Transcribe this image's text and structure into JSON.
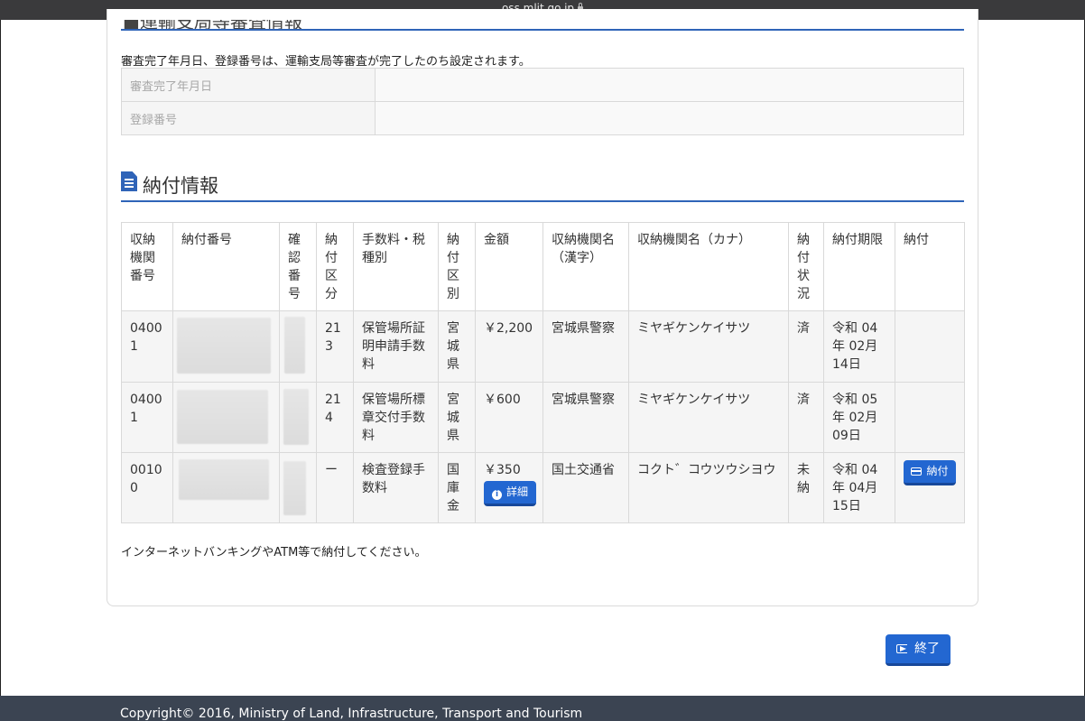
{
  "browser": {
    "url": "oss.mlit.go.jp"
  },
  "registration": {
    "note": "審査完了年月日、登録番号は、運輸支局等審査が完了したのち設定されます。",
    "rows": [
      {
        "label": "審査完了年月日",
        "value": ""
      },
      {
        "label": "登録番号",
        "value": ""
      }
    ]
  },
  "payment": {
    "heading": "納付情報",
    "headers": [
      "収納機関番号",
      "納付番号",
      "確認番号",
      "納付区分",
      "手数料・税種別",
      "納付区別",
      "金額",
      "収納機関名（漢字）",
      "収納機関名（カナ）",
      "納付状況",
      "納付期限",
      "納付"
    ],
    "rows": [
      {
        "agency_no": "04001",
        "category": "213",
        "fee_type": "保管場所証明申請手数料",
        "division": "宮城県",
        "amount": "￥2,200",
        "agency_kanji": "宮城県警察",
        "agency_kana": "ミヤギケンケイサツ",
        "status": "済",
        "due": "令和 04年 02月 14日"
      },
      {
        "agency_no": "04001",
        "category": "214",
        "fee_type": "保管場所標章交付手数料",
        "division": "宮城県",
        "amount": "￥600",
        "agency_kanji": "宮城県警察",
        "agency_kana": "ミヤギケンケイサツ",
        "status": "済",
        "due": "令和 05年 02月 09日"
      },
      {
        "agency_no": "00100",
        "category": "ー",
        "fee_type": "検査登録手数料",
        "division": "国庫金",
        "amount": "￥350",
        "detail_label": "詳細",
        "agency_kanji": "国土交通省",
        "agency_kana": "コクト゛コウツウシヨウ",
        "status": "未納",
        "due": "令和 04年 04月 15日",
        "pay_label": "納付"
      }
    ],
    "note": "インターネットバンキングやATM等で納付してください。"
  },
  "actions": {
    "end_label": "終了"
  },
  "footer": {
    "copyright": "Copyright© 2016, Ministry of Land, Infrastructure, Transport and Tourism"
  },
  "icons": {
    "document": "document-icon",
    "info": "info-icon",
    "credit_card": "credit-card-icon",
    "exit": "sign-out-icon",
    "lock": "lock-icon"
  }
}
